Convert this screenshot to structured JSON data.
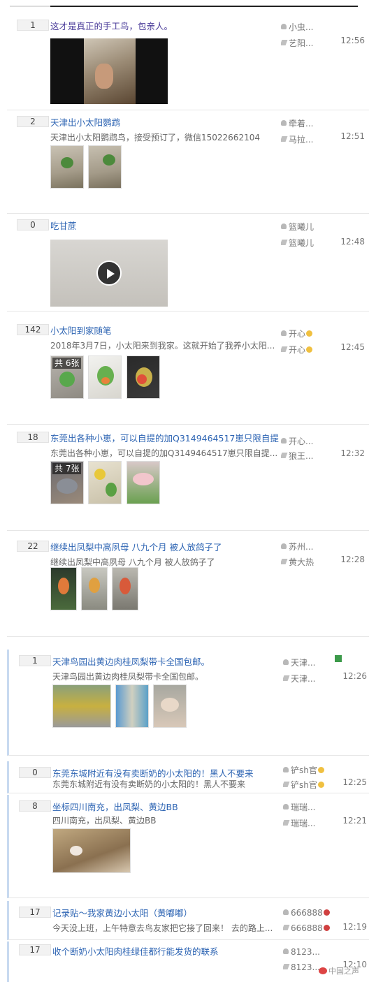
{
  "posts": [
    {
      "replies": "1",
      "title": "这才是真正的手工鸟，包亲人。",
      "summary": "",
      "author": "小虫...",
      "last_replier": "艺阳...",
      "time": "12:56",
      "media": "video-photo"
    },
    {
      "replies": "2",
      "title": "天津出小太阳鹦鹉",
      "summary": "天津出小太阳鹦鹉鸟，接受预订了，微信15022662104",
      "author": "牵着...",
      "last_replier": "马拉...",
      "time": "12:51"
    },
    {
      "replies": "0",
      "title": "吃甘蔗",
      "summary": "",
      "author": "篮曦儿",
      "last_replier": "篮曦儿",
      "time": "12:48",
      "media": "video"
    },
    {
      "replies": "142",
      "title": "小太阳到家随笔",
      "summary": "2018年3月7日，小太阳来到我家。这就开始了我养小太阳...",
      "author": "开心",
      "last_replier": "开心",
      "time": "12:45",
      "photo_count": "共 6张"
    },
    {
      "replies": "18",
      "title": "东莞出各种小崽，可以自提的加Q3149464517崽只限自提",
      "summary": "东莞出各种小崽，可以自提的加Q3149464517崽只限自提...",
      "author": "开心...",
      "last_replier": "狼王...",
      "time": "12:32",
      "photo_count": "共 7张"
    },
    {
      "replies": "22",
      "title": "继续出凤梨中高夙母 八九个月 被人放鸽子了",
      "summary": "继续出凤梨中高夙母 八九个月 被人放鸽子了",
      "author": "苏州...",
      "last_replier": "黄大热",
      "time": "12:28"
    },
    {
      "replies": "1",
      "title": "天津鸟园出黄边肉桂凤梨带卡全国包邮。",
      "summary": "天津鸟园出黄边肉桂凤梨带卡全国包邮。",
      "author": "天津...",
      "last_replier": "天津...",
      "time": "12:26"
    },
    {
      "replies": "0",
      "title": "东莞东城附近有没有卖断奶的小太阳的！黑人不要来",
      "summary": "东莞东城附近有没有卖断奶的小太阳的！黑人不要来",
      "author": "铲sh官",
      "last_replier": "铲sh官",
      "time": "12:25"
    },
    {
      "replies": "8",
      "title": "坐标四川南充，出凤梨、黄边BB",
      "summary": "四川南充，出凤梨、黄边BB",
      "author": "瑞瑞...",
      "last_replier": "瑞瑞...",
      "time": "12:21"
    },
    {
      "replies": "17",
      "title": "记录贴～我家黄边小太阳（黄嘟嘟）",
      "summary": "今天没上班，上午特意去鸟友家把它接了回来！ 去的路上...",
      "author": "666888",
      "last_replier": "666888",
      "time": "12:19"
    },
    {
      "replies": "17",
      "title": "收个断奶小太阳肉桂绿佳都行能发货的联系",
      "summary": "",
      "author": "8123...",
      "last_replier": "8123...",
      "time": "12:10"
    }
  ],
  "watermark": "中国之声",
  "colors": {
    "title_link": "#2d64b3",
    "title_visited": "#4b3d9a",
    "time": "#777777"
  },
  "icons": {
    "play": "play-icon",
    "author": "user-icon",
    "last_replier": "pen-icon",
    "weibo": "weibo-icon"
  }
}
